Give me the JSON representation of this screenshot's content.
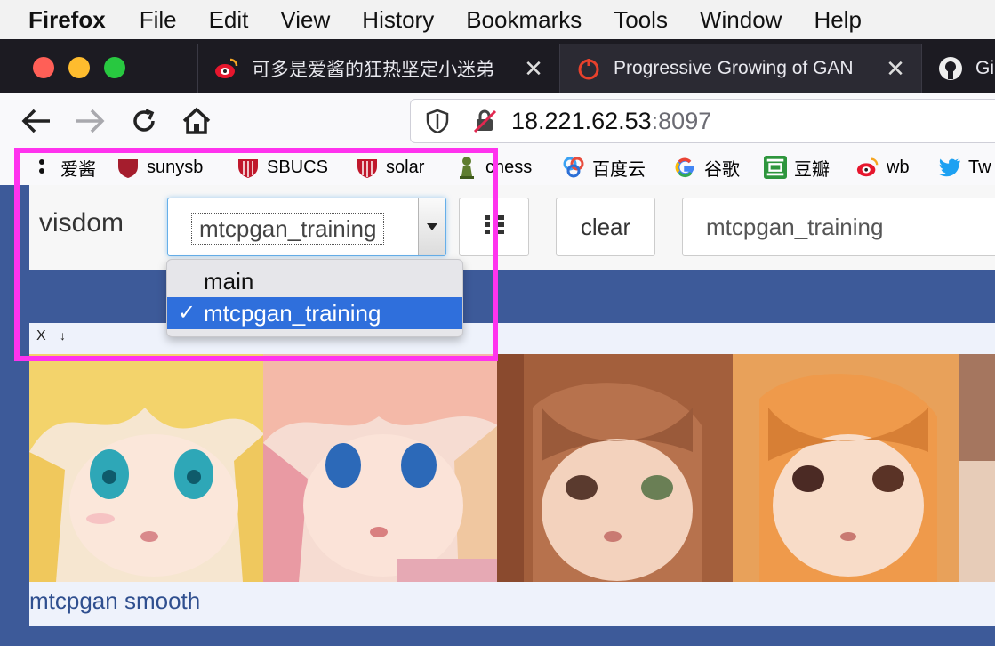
{
  "menubar": {
    "app": "Firefox",
    "items": [
      "File",
      "Edit",
      "View",
      "History",
      "Bookmarks",
      "Tools",
      "Window",
      "Help"
    ]
  },
  "tabs": [
    {
      "title": "可多是爱酱的狂热坚定小迷弟",
      "icon": "weibo-icon"
    },
    {
      "title": "Progressive Growing of GAN",
      "icon": "paper-icon"
    },
    {
      "title": "Gi",
      "icon": "github-icon"
    }
  ],
  "urlbar": {
    "host": "18.221.62.53",
    "port": ":8097"
  },
  "bookmarks": [
    {
      "label": "爱酱",
      "icon": "dot-icon"
    },
    {
      "label": "sunysb",
      "icon": "shield-icon"
    },
    {
      "label": "SBUCS",
      "icon": "shield-icon"
    },
    {
      "label": "solar",
      "icon": "shield-icon"
    },
    {
      "label": "chess",
      "icon": "pawn-icon"
    },
    {
      "label": "百度云",
      "icon": "cloud-icon"
    },
    {
      "label": "谷歌",
      "icon": "google-icon"
    },
    {
      "label": "豆瓣",
      "icon": "douban-icon"
    },
    {
      "label": "wb",
      "icon": "weibo-icon"
    },
    {
      "label": "Tw",
      "icon": "twitter-icon"
    }
  ],
  "visdom": {
    "logo": "visdom",
    "env_value": "mtcpgan_training",
    "env_options": [
      {
        "label": "main",
        "selected": false
      },
      {
        "label": "mtcpgan_training",
        "selected": true
      }
    ],
    "clear_label": "clear",
    "filter_value": "mtcpgan_training"
  },
  "pane": {
    "close_label": "X",
    "download_label": "↓",
    "caption": "mtcpgan smooth"
  },
  "colors": {
    "highlight": "#ff33ee",
    "page_bg": "#3d5a99",
    "selected_option": "#2f6fdc"
  }
}
